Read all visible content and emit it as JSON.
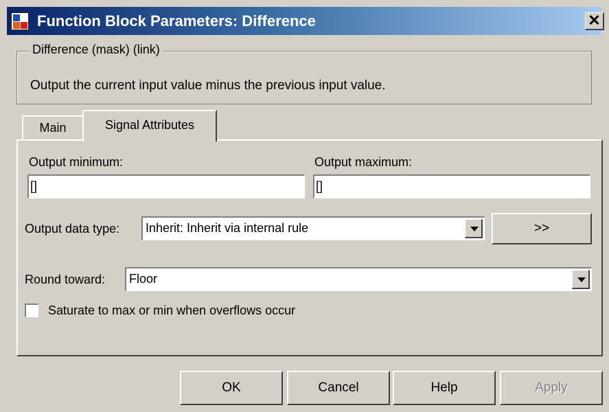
{
  "window": {
    "title": "Function Block Parameters: Difference",
    "close_glyph": "✕",
    "icon": "simulink-block-icon"
  },
  "group": {
    "legend": "Difference (mask) (link)",
    "description": "Output the current input value minus the previous input value."
  },
  "tabs": [
    {
      "label": "Main",
      "selected": false
    },
    {
      "label": "Signal Attributes",
      "selected": true
    }
  ],
  "form": {
    "output_min_label": "Output minimum:",
    "output_min_value": "[]",
    "output_max_label": "Output maximum:",
    "output_max_value": "[]",
    "data_type_label": "Output data type:",
    "data_type_value": "Inherit: Inherit via internal rule",
    "data_type_button": ">>",
    "round_label": "Round toward:",
    "round_value": "Floor",
    "saturate_label": "Saturate to max or min when overflows occur",
    "saturate_checked": false
  },
  "buttons": {
    "ok": "OK",
    "cancel": "Cancel",
    "help": "Help",
    "apply": "Apply"
  },
  "colors": {
    "face": "#d4d0c8",
    "title_start": "#0a246a",
    "title_end": "#a6caf0"
  }
}
